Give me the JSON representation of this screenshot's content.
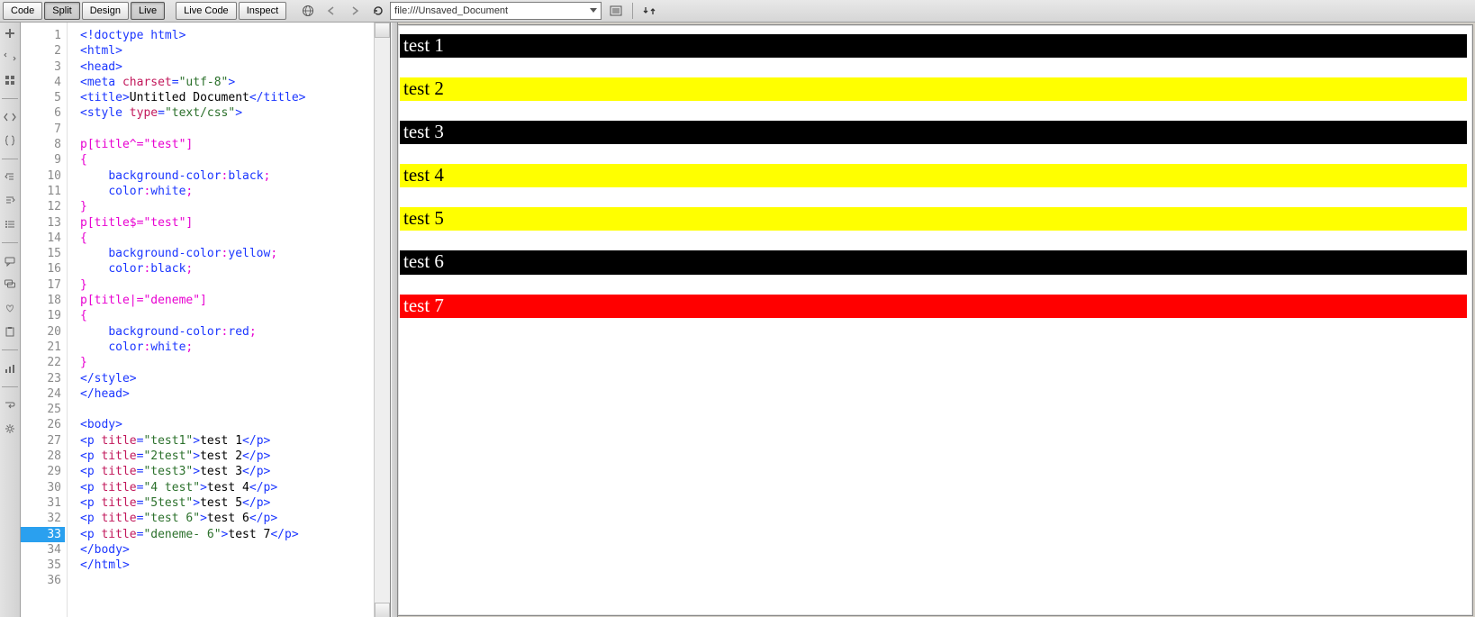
{
  "toolbar": {
    "code_label": "Code",
    "split_label": "Split",
    "design_label": "Design",
    "live_label": "Live",
    "live_code_label": "Live Code",
    "inspect_label": "Inspect",
    "url": "file:///Unsaved_Document"
  },
  "code_lines": [
    {
      "n": 1,
      "html": "<span class='tag'>&lt;!doctype html&gt;</span>"
    },
    {
      "n": 2,
      "html": "<span class='tag'>&lt;html&gt;</span>"
    },
    {
      "n": 3,
      "html": "<span class='tag'>&lt;head&gt;</span>"
    },
    {
      "n": 4,
      "html": "<span class='tag'>&lt;meta </span><span class='attr-name'>charset</span><span class='tag'>=</span><span class='attr-val'>\"utf-8\"</span><span class='tag'>&gt;</span>"
    },
    {
      "n": 5,
      "html": "<span class='tag'>&lt;title&gt;</span><span class='text-plain'>Untitled Document</span><span class='tag'>&lt;/title&gt;</span>"
    },
    {
      "n": 6,
      "html": "<span class='tag'>&lt;style </span><span class='attr-name'>type</span><span class='tag'>=</span><span class='attr-val'>\"text/css\"</span><span class='tag'>&gt;</span>"
    },
    {
      "n": 7,
      "html": ""
    },
    {
      "n": 8,
      "html": "<span class='pink'>p[title^=\"test\"]</span>"
    },
    {
      "n": 9,
      "html": "<span class='pink'>{</span>"
    },
    {
      "n": 10,
      "html": "    <span class='blue'>background-color</span><span class='pink'>:</span><span class='blue'>black</span><span class='pink'>;</span>"
    },
    {
      "n": 11,
      "html": "    <span class='blue'>color</span><span class='pink'>:</span><span class='blue'>white</span><span class='pink'>;</span>"
    },
    {
      "n": 12,
      "html": "<span class='pink'>}</span>"
    },
    {
      "n": 13,
      "html": "<span class='pink'>p[title$=\"test\"]</span>"
    },
    {
      "n": 14,
      "html": "<span class='pink'>{</span>"
    },
    {
      "n": 15,
      "html": "    <span class='blue'>background-color</span><span class='pink'>:</span><span class='blue'>yellow</span><span class='pink'>;</span>"
    },
    {
      "n": 16,
      "html": "    <span class='blue'>color</span><span class='pink'>:</span><span class='blue'>black</span><span class='pink'>;</span>"
    },
    {
      "n": 17,
      "html": "<span class='pink'>}</span>"
    },
    {
      "n": 18,
      "html": "<span class='pink'>p[title|=\"deneme\"]</span>"
    },
    {
      "n": 19,
      "html": "<span class='pink'>{</span>"
    },
    {
      "n": 20,
      "html": "    <span class='blue'>background-color</span><span class='pink'>:</span><span class='blue'>red</span><span class='pink'>;</span>"
    },
    {
      "n": 21,
      "html": "    <span class='blue'>color</span><span class='pink'>:</span><span class='blue'>white</span><span class='pink'>;</span>"
    },
    {
      "n": 22,
      "html": "<span class='pink'>}</span>"
    },
    {
      "n": 23,
      "html": "<span class='tag'>&lt;/style&gt;</span>"
    },
    {
      "n": 24,
      "html": "<span class='tag'>&lt;/head&gt;</span>"
    },
    {
      "n": 25,
      "html": ""
    },
    {
      "n": 26,
      "html": "<span class='tag'>&lt;body&gt;</span>"
    },
    {
      "n": 27,
      "html": "<span class='tag'>&lt;p </span><span class='attr-name'>title</span><span class='tag'>=</span><span class='attr-val'>\"test1\"</span><span class='tag'>&gt;</span><span class='text-plain'>test 1</span><span class='tag'>&lt;/p&gt;</span>"
    },
    {
      "n": 28,
      "html": "<span class='tag'>&lt;p </span><span class='attr-name'>title</span><span class='tag'>=</span><span class='attr-val'>\"2test\"</span><span class='tag'>&gt;</span><span class='text-plain'>test 2</span><span class='tag'>&lt;/p&gt;</span>"
    },
    {
      "n": 29,
      "html": "<span class='tag'>&lt;p </span><span class='attr-name'>title</span><span class='tag'>=</span><span class='attr-val'>\"test3\"</span><span class='tag'>&gt;</span><span class='text-plain'>test 3</span><span class='tag'>&lt;/p&gt;</span>"
    },
    {
      "n": 30,
      "html": "<span class='tag'>&lt;p </span><span class='attr-name'>title</span><span class='tag'>=</span><span class='attr-val'>\"4 test\"</span><span class='tag'>&gt;</span><span class='text-plain'>test 4</span><span class='tag'>&lt;/p&gt;</span>"
    },
    {
      "n": 31,
      "html": "<span class='tag'>&lt;p </span><span class='attr-name'>title</span><span class='tag'>=</span><span class='attr-val'>\"5test\"</span><span class='tag'>&gt;</span><span class='text-plain'>test 5</span><span class='tag'>&lt;/p&gt;</span>"
    },
    {
      "n": 32,
      "html": "<span class='tag'>&lt;p </span><span class='attr-name'>title</span><span class='tag'>=</span><span class='attr-val'>\"test 6\"</span><span class='tag'>&gt;</span><span class='text-plain'>test 6</span><span class='tag'>&lt;/p&gt;</span>"
    },
    {
      "n": 33,
      "active": true,
      "html": "<span class='tag'>&lt;p </span><span class='attr-name'>title</span><span class='tag'>=</span><span class='attr-val'>\"deneme- 6\"</span><span class='tag'>&gt;</span><span class='text-plain'>test 7</span><span class='tag'>&lt;/p&gt;</span>"
    },
    {
      "n": 34,
      "html": "<span class='tag'>&lt;/body&gt;</span>"
    },
    {
      "n": 35,
      "html": "<span class='tag'>&lt;/html&gt;</span>"
    },
    {
      "n": 36,
      "html": ""
    }
  ],
  "preview": {
    "items": [
      {
        "text": "test 1",
        "cls": "p-black"
      },
      {
        "text": "test 2",
        "cls": "p-yellow"
      },
      {
        "text": "test 3",
        "cls": "p-black"
      },
      {
        "text": "test 4",
        "cls": "p-yellow"
      },
      {
        "text": "test 5",
        "cls": "p-yellow"
      },
      {
        "text": "test 6",
        "cls": "p-black"
      },
      {
        "text": "test 7",
        "cls": "p-red"
      }
    ]
  },
  "active_line": 33
}
